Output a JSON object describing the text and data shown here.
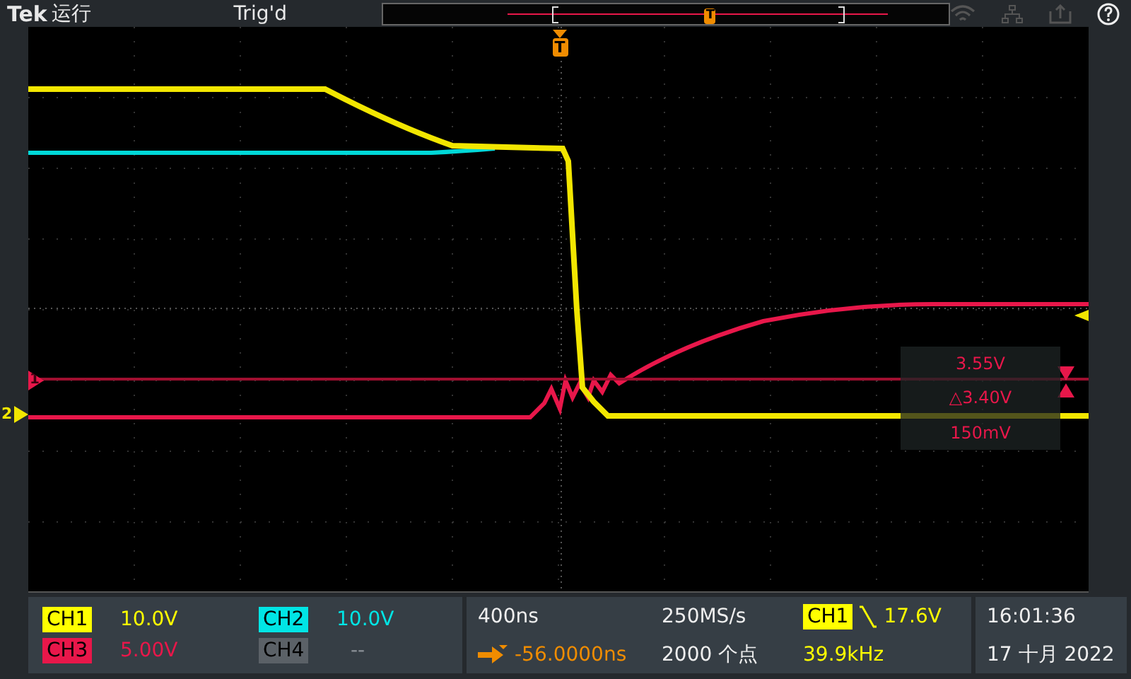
{
  "header": {
    "brand": "Tek",
    "run_state": "运行",
    "trigger_status": "Trig'd",
    "record_marker": "T"
  },
  "graticule": {
    "trigger_marker": "T",
    "channel_markers": [
      {
        "label": "1",
        "color": "#e8174a"
      },
      {
        "label": "2",
        "color": "#f2e600"
      }
    ],
    "cursor_readout": {
      "upper": "3.55V",
      "delta": "△3.40V",
      "lower": "150mV"
    }
  },
  "channels": [
    {
      "label": "CH1",
      "scale": "10.0V",
      "color": "#ffff00",
      "on": true
    },
    {
      "label": "CH2",
      "scale": "10.0V",
      "color": "#00e5e5",
      "on": true
    },
    {
      "label": "CH3",
      "scale": "5.00V",
      "color": "#e8174a",
      "on": true
    },
    {
      "label": "CH4",
      "scale": "--",
      "color": "#5b6167",
      "on": false
    }
  ],
  "timebase": {
    "scale": "400ns",
    "position": "-56.0000ns",
    "sample_rate": "250MS/s",
    "record_length": "2000 个点"
  },
  "trigger": {
    "source": "CH1",
    "level": "17.6V",
    "frequency": "39.9kHz"
  },
  "clock": {
    "time": "16:01:36",
    "date": "17 十月 2022"
  }
}
